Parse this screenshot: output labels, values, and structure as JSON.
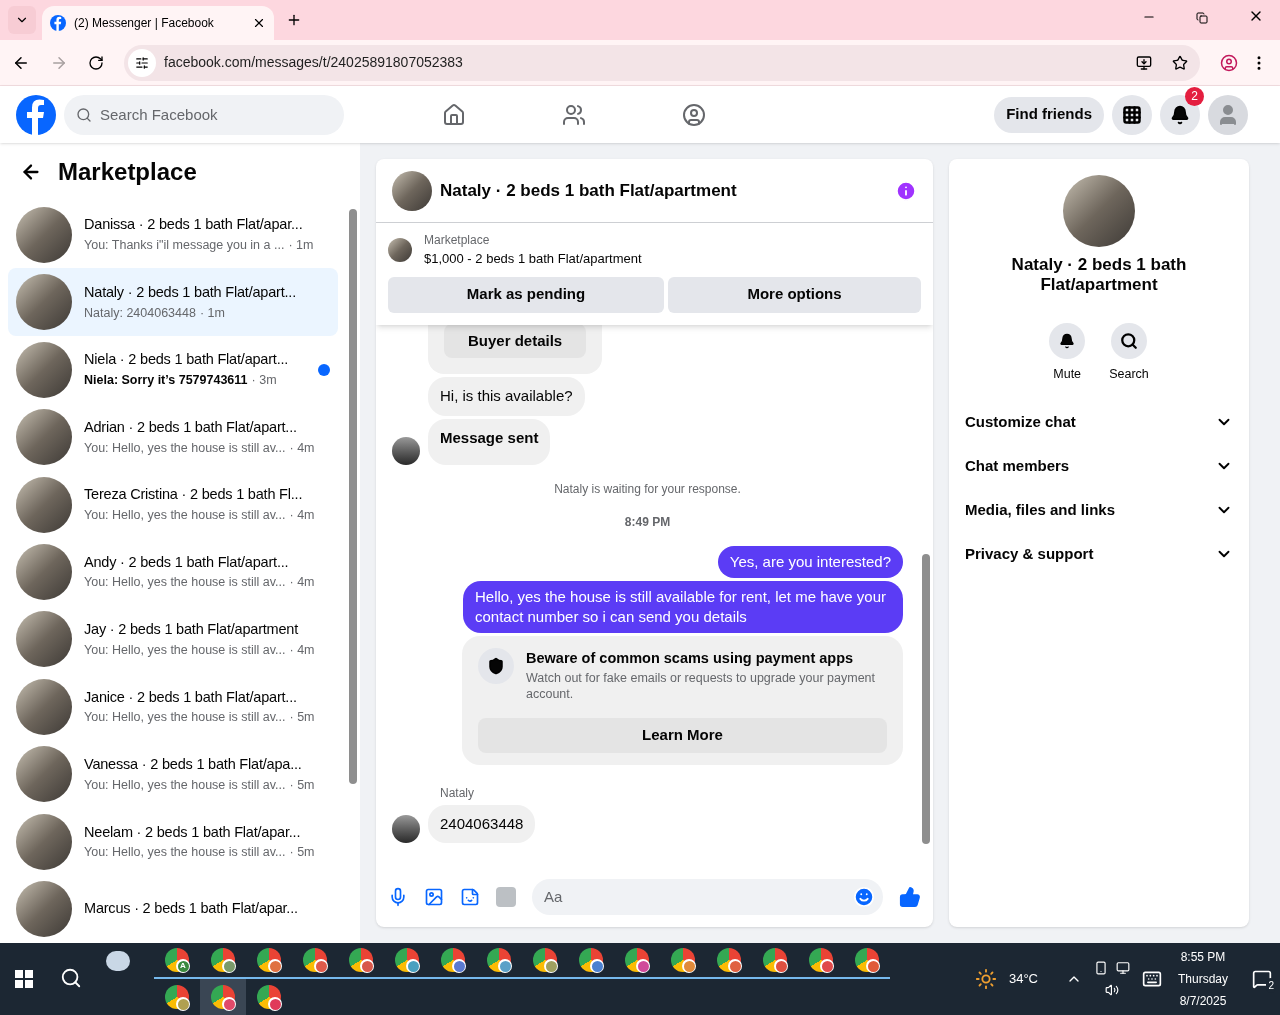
{
  "browser": {
    "tab_title": "(2) Messenger | Facebook",
    "url": "facebook.com/messages/t/24025891807052383"
  },
  "header": {
    "search_placeholder": "Search Facebook",
    "find_friends": "Find friends",
    "notification_count": "2"
  },
  "sidebar": {
    "title": "Marketplace",
    "conversations": [
      {
        "name": "Danissa · 2 beds 1 bath Flat/apar...",
        "preview": "You: Thanks i\"il message you in a ...",
        "time": "· 1m",
        "selected": false,
        "unread": false
      },
      {
        "name": "Nataly · 2 beds 1 bath Flat/apart...",
        "preview": "Nataly: 2404063448",
        "time": "· 1m",
        "selected": true,
        "unread": false
      },
      {
        "name": "Niela · 2 beds 1 bath Flat/apart...",
        "preview": "Niela: Sorry it’s 7579743611",
        "time": "· 3m",
        "selected": false,
        "unread": true
      },
      {
        "name": "Adrian · 2 beds 1 bath Flat/apart...",
        "preview": "You: Hello, yes the house is still av...",
        "time": "· 4m",
        "selected": false,
        "unread": false
      },
      {
        "name": "Tereza Cristina · 2 beds 1 bath Fl...",
        "preview": "You: Hello, yes the house is still av...",
        "time": "· 4m",
        "selected": false,
        "unread": false
      },
      {
        "name": "Andy · 2 beds 1 bath Flat/apart...",
        "preview": "You: Hello, yes the house is still av...",
        "time": "· 4m",
        "selected": false,
        "unread": false
      },
      {
        "name": "Jay · 2 beds 1 bath Flat/apartment",
        "preview": "You: Hello, yes the house is still av...",
        "time": "· 4m",
        "selected": false,
        "unread": false
      },
      {
        "name": "Janice · 2 beds 1 bath Flat/apart...",
        "preview": "You: Hello, yes the house is still av...",
        "time": "· 5m",
        "selected": false,
        "unread": false
      },
      {
        "name": "Vanessa · 2 beds 1 bath Flat/apa...",
        "preview": "You: Hello, yes the house is still av...",
        "time": "· 5m",
        "selected": false,
        "unread": false
      },
      {
        "name": "Neelam · 2 beds 1 bath Flat/apar...",
        "preview": "You: Hello, yes the house is still av...",
        "time": "· 5m",
        "selected": false,
        "unread": false
      },
      {
        "name": "Marcus · 2 beds 1 bath Flat/apar...",
        "selected": false,
        "unread": false
      }
    ]
  },
  "chat": {
    "title": "Nataly · 2 beds 1 bath Flat/apartment",
    "listing": {
      "source": "Marketplace",
      "price_title": "$1,000 - 2 beds 1 bath Flat/apartment",
      "buttons": [
        "Mark as pending",
        "More options"
      ]
    },
    "messages": [
      {
        "kind": "buyer_card",
        "button": "Buyer details"
      },
      {
        "kind": "incoming",
        "text": "Hi, is this available?",
        "avatar": false,
        "bold": false
      },
      {
        "kind": "incoming",
        "text": "Message sent",
        "avatar": true,
        "bold": true
      },
      {
        "kind": "status",
        "text": "Nataly is waiting for your response."
      },
      {
        "kind": "time",
        "text": "8:49 PM"
      },
      {
        "kind": "outgoing",
        "text": "Yes, are you interested?"
      },
      {
        "kind": "outgoing",
        "text": "Hello, yes the house is still available for rent, let me have your contact number so i can send you details"
      },
      {
        "kind": "notice",
        "title": "Beware of common scams using payment apps",
        "body": "Watch out for fake emails or requests to upgrade your payment account.",
        "button": "Learn More"
      },
      {
        "kind": "sender",
        "text": "Nataly"
      },
      {
        "kind": "incoming",
        "text": "2404063448",
        "avatar": true,
        "bold": false
      }
    ],
    "composer_placeholder": "Aa"
  },
  "details": {
    "title": "Nataly · 2 beds 1 bath Flat/apartment",
    "actions": [
      {
        "kind": "mute",
        "label": "Mute"
      },
      {
        "kind": "search",
        "label": "Search"
      }
    ],
    "sections": [
      "Customize chat",
      "Chat members",
      "Media, files and links",
      "Privacy & support"
    ]
  },
  "taskbar": {
    "apps": [
      {
        "color": "#3b8a3e",
        "label": "A",
        "open": true,
        "selected": false
      },
      {
        "color": "#7a9a6a",
        "open": true,
        "selected": false
      },
      {
        "color": "#e07040",
        "open": true,
        "selected": false
      },
      {
        "color": "#e05a4a",
        "open": true,
        "selected": false
      },
      {
        "color": "#d8584a",
        "open": true,
        "selected": false
      },
      {
        "color": "#4aa0c0",
        "open": true,
        "selected": false
      },
      {
        "color": "#5a7ad0",
        "open": true,
        "selected": false
      },
      {
        "color": "#5aa0c8",
        "open": true,
        "selected": false
      },
      {
        "color": "#a0a060",
        "open": true,
        "selected": false
      },
      {
        "color": "#4a80d0",
        "open": true,
        "selected": false
      },
      {
        "color": "#d04a9a",
        "open": true,
        "selected": false
      },
      {
        "color": "#e08a3a",
        "open": true,
        "selected": false
      },
      {
        "color": "#e06040",
        "open": true,
        "selected": false
      },
      {
        "color": "#e05040",
        "open": true,
        "selected": false
      },
      {
        "color": "#e04a4a",
        "open": true,
        "selected": false
      },
      {
        "color": "#e05a3a",
        "open": true,
        "selected": false
      },
      {
        "color": "#b0a050",
        "open": false,
        "selected": false
      },
      {
        "color": "#e04a6a",
        "open": false,
        "selected": true
      },
      {
        "color": "#e03a5a",
        "open": false,
        "selected": false
      }
    ],
    "weather": "34°C",
    "time": "8:55 PM",
    "day": "Thursday",
    "date": "8/7/2025",
    "notifications": "2"
  }
}
